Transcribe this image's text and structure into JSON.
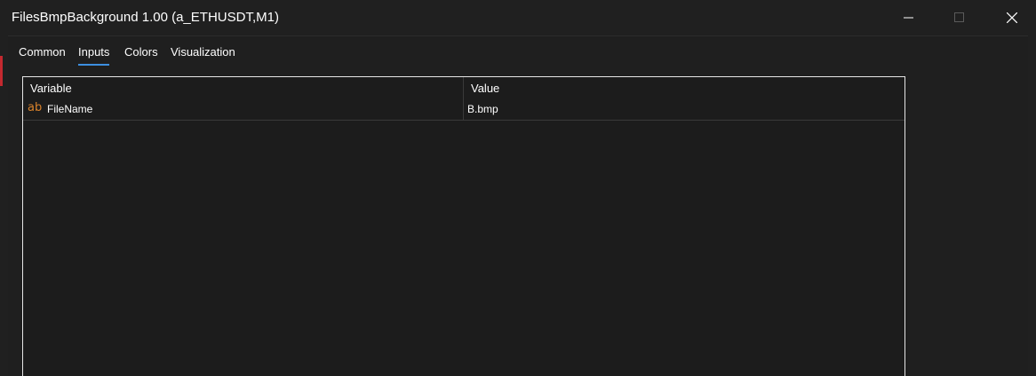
{
  "window": {
    "title": "FilesBmpBackground 1.00 (a_ETHUSDT,M1)"
  },
  "tabs": [
    {
      "label": "Common"
    },
    {
      "label": "Inputs"
    },
    {
      "label": "Colors"
    },
    {
      "label": "Visualization"
    }
  ],
  "active_tab": "Inputs",
  "grid": {
    "headers": {
      "variable": "Variable",
      "value": "Value"
    },
    "rows": [
      {
        "type_icon": "ab",
        "name": "FileName",
        "value": "B.bmp"
      }
    ]
  },
  "colors": {
    "background": "#202020",
    "tab_underline": "#3d8fe0",
    "string_icon": "#d9822b",
    "accent_bar": "#c4292f"
  }
}
